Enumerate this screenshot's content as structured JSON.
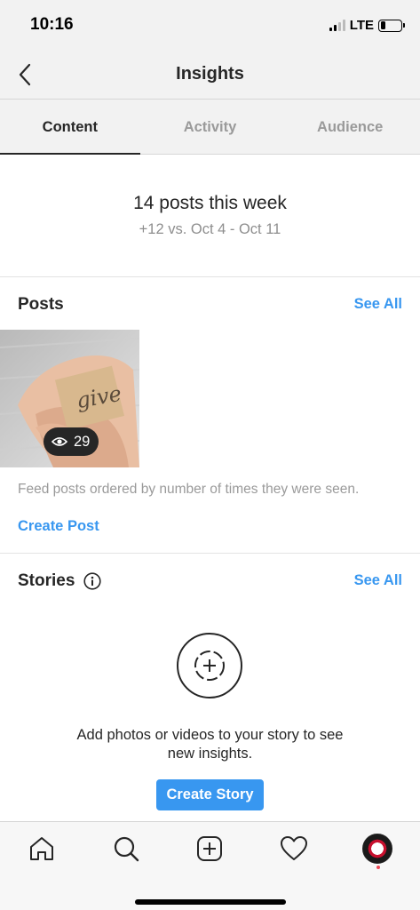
{
  "status_bar": {
    "time": "10:16",
    "network": "LTE",
    "battery_level": 0.25
  },
  "header": {
    "title": "Insights",
    "back_icon": "chevron-left-icon"
  },
  "tabs": [
    {
      "label": "Content",
      "active": true
    },
    {
      "label": "Activity",
      "active": false
    },
    {
      "label": "Audience",
      "active": false
    }
  ],
  "summary": {
    "count_text": "14 posts this week",
    "comparison_text": "+12 vs. Oct 4 - Oct 11"
  },
  "posts": {
    "title": "Posts",
    "see_all": "See All",
    "thumbnail": {
      "views": "29",
      "view_icon": "eye-icon",
      "image_text": "give"
    },
    "caption": "Feed posts ordered by number of times they were seen.",
    "create_label": "Create Post"
  },
  "stories": {
    "title": "Stories",
    "info_icon": "info-icon",
    "see_all": "See All",
    "empty_icon": "add-story-icon",
    "message_line1": "Add photos or videos to your story to see",
    "message_line2": "new insights.",
    "create_label": "Create Story"
  },
  "bottom_nav": {
    "items": [
      "home-icon",
      "search-icon",
      "add-post-icon",
      "heart-icon",
      "profile-avatar"
    ]
  },
  "colors": {
    "accent": "#3897f0",
    "text": "#262626",
    "muted": "#8e8e8e",
    "notification_dot": "#ed4956"
  }
}
